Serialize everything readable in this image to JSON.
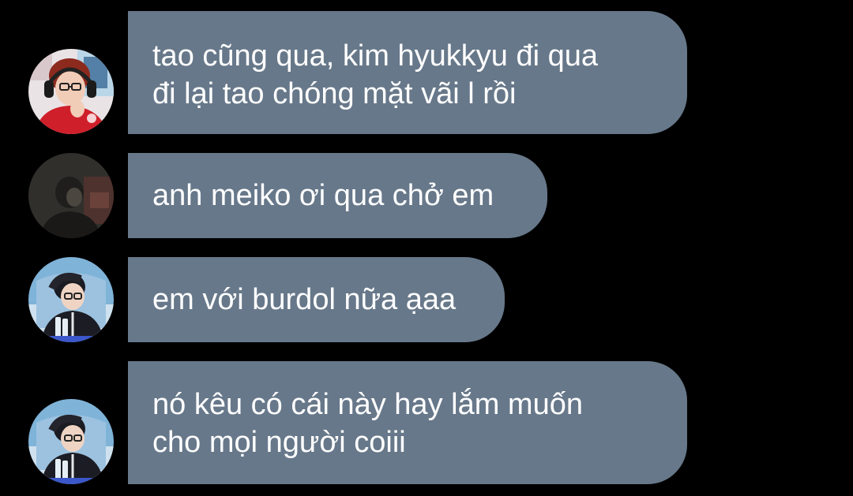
{
  "messages": [
    {
      "avatar": "avatar-red-jersey-headset",
      "lines": [
        "tao cũng qua, kim hyukkyu đi qua",
        "đi lại tao chóng mặt vãi l rồi"
      ]
    },
    {
      "avatar": "avatar-dark-figure",
      "lines": [
        "anh meiko ơi qua chở em"
      ]
    },
    {
      "avatar": "avatar-player-glasses-blue-chair",
      "lines": [
        "em với burdol nữa ạaa"
      ]
    },
    {
      "avatar": "avatar-player-glasses-blue-chair",
      "lines": [
        "nó kêu có cái này hay lắm muốn",
        "cho mọi người coiii"
      ]
    }
  ],
  "colors": {
    "background": "#000000",
    "bubble": "#67788a",
    "text": "#ffffff"
  }
}
